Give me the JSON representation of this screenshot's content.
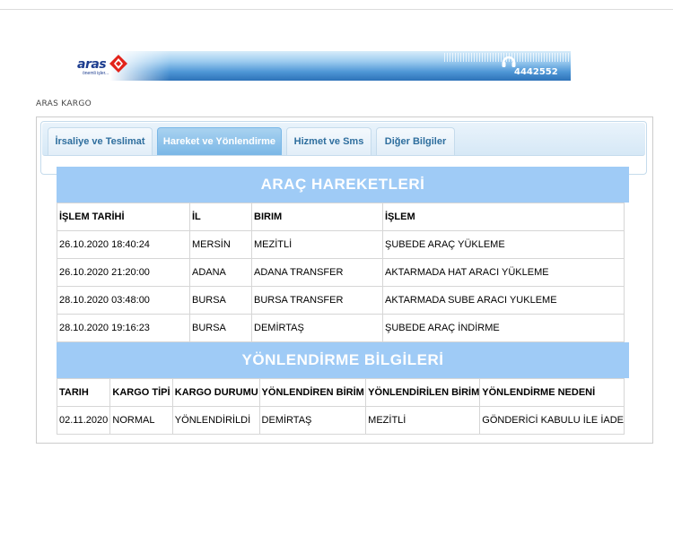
{
  "banner": {
    "logo_text": "aras",
    "logo_sub": "önemli işler...",
    "phone": "4442552"
  },
  "site_title": "ARAS KARGO",
  "tabs": [
    {
      "label": "İrsaliye ve Teslimat"
    },
    {
      "label": "Hareket ve Yönlendirme"
    },
    {
      "label": "Hizmet ve Sms"
    },
    {
      "label": "Diğer Bilgiler"
    }
  ],
  "active_tab": "Hareket ve Yönlendirme",
  "movements": {
    "title": "ARAÇ HAREKETLERİ",
    "headers": [
      "İŞLEM TARİHİ",
      "İL",
      "BIRIM",
      "İŞLEM"
    ],
    "rows": [
      [
        "26.10.2020 18:40:24",
        "MERSİN",
        "MEZİTLİ",
        "ŞUBEDE ARAÇ YÜKLEME"
      ],
      [
        "26.10.2020 21:20:00",
        "ADANA",
        "ADANA TRANSFER",
        "AKTARMADA HAT ARACI YÜKLEME"
      ],
      [
        "28.10.2020 03:48:00",
        "BURSA",
        "BURSA TRANSFER",
        "AKTARMADA SUBE ARACI YUKLEME"
      ],
      [
        "28.10.2020 19:16:23",
        "BURSA",
        "DEMİRTAŞ",
        "ŞUBEDE ARAÇ İNDİRME"
      ]
    ]
  },
  "redirections": {
    "title": "YÖNLENDİRME BİLGİLERİ",
    "headers": [
      "TARIH",
      "KARGO TİPİ",
      "KARGO DURUMU",
      "YÖNLENDİREN BİRİM",
      "YÖNLENDİRİLEN BİRİM",
      "YÖNLENDİRME NEDENİ"
    ],
    "rows": [
      [
        "02.11.2020",
        "NORMAL",
        "YÖNLENDİRİLDİ",
        "DEMİRTAŞ",
        "MEZİTLİ",
        "GÖNDERİCİ KABULU İLE İADE"
      ]
    ]
  },
  "colors": {
    "section_header": "#9fcbf6",
    "active_tab": "#7ab7e6",
    "tab_text": "#2e6e9e"
  }
}
